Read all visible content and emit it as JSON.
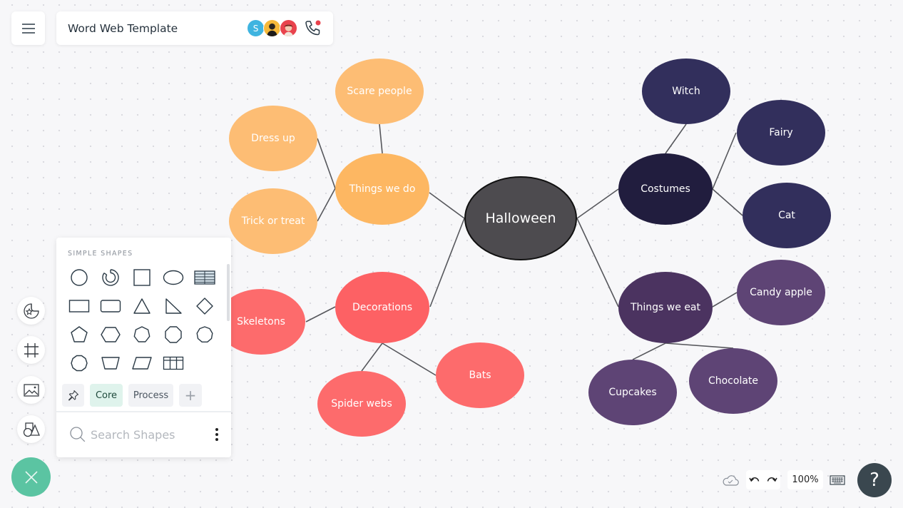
{
  "header": {
    "title": "Word Web Template",
    "collaborators": [
      {
        "initial": "S",
        "color": "#3fb4e0"
      },
      {
        "initial": "",
        "color": "#f6b93b"
      },
      {
        "initial": "",
        "color": "#e9434d"
      }
    ],
    "call_indicator_color": "#e9434d"
  },
  "sidebar": {
    "items": [
      "templates-icon",
      "frame-icon",
      "image-icon",
      "shapes-icon"
    ],
    "fab_color": "#5bc4a2"
  },
  "shapes_panel": {
    "title": "SIMPLE SHAPES",
    "shapes": [
      "circle",
      "donut",
      "square",
      "ellipse",
      "table-striped",
      "rectangle",
      "rounded-rectangle",
      "triangle",
      "right-triangle",
      "diamond",
      "pentagon",
      "hexagon",
      "heptagon",
      "octagon",
      "nonagon",
      "decagon",
      "trapezoid",
      "parallelogram",
      "table-grid"
    ],
    "tabs": [
      {
        "label": "",
        "icon": "pin-icon"
      },
      {
        "label": "Core",
        "active": true
      },
      {
        "label": "Process"
      },
      {
        "label": "+"
      }
    ],
    "search": {
      "placeholder": "Search Shapes",
      "value": ""
    }
  },
  "diagram": {
    "center": {
      "label": "Halloween",
      "color": "#4d4b4f"
    },
    "branches": [
      {
        "id": "do",
        "label": "Things we do",
        "color": "#fdb762",
        "children": [
          {
            "id": "scare",
            "label": "Scare people"
          },
          {
            "id": "dress",
            "label": "Dress up"
          },
          {
            "id": "trick",
            "label": "Trick or treat"
          }
        ]
      },
      {
        "id": "deco",
        "label": "Decorations",
        "color": "#fd6164",
        "children": [
          {
            "id": "skel",
            "label": "Skeletons"
          },
          {
            "id": "spider",
            "label": "Spider webs"
          },
          {
            "id": "bats",
            "label": "Bats"
          }
        ]
      },
      {
        "id": "cost",
        "label": "Costumes",
        "color": "#211d3e",
        "children": [
          {
            "id": "witch",
            "label": "Witch"
          },
          {
            "id": "fairy",
            "label": "Fairy"
          },
          {
            "id": "cat",
            "label": "Cat"
          }
        ]
      },
      {
        "id": "eat",
        "label": "Things we eat",
        "color": "#4b3360",
        "children": [
          {
            "id": "candy",
            "label": "Candy apple"
          },
          {
            "id": "cupcakes",
            "label": "Cupcakes"
          },
          {
            "id": "choc",
            "label": "Chocolate"
          }
        ]
      }
    ],
    "child_colors": {
      "do": "#fdbd74",
      "deco": "#fd6b6c",
      "cost": "#322f5c",
      "eat": "#5e4475"
    }
  },
  "footer": {
    "zoom": "100%",
    "help": "?"
  }
}
